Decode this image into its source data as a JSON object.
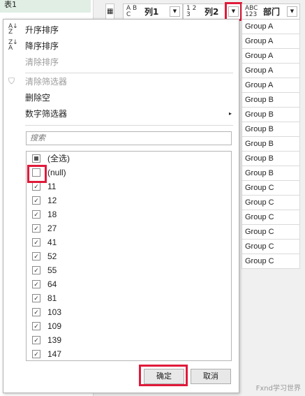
{
  "query_pane": {
    "item": "表1"
  },
  "columns": [
    {
      "type_badge": "A B C",
      "label": "列1"
    },
    {
      "type_badge": "1 2 3",
      "label": "列2"
    },
    {
      "type_badge": "ABC 123",
      "label": "部门"
    }
  ],
  "dept_values": [
    "Group A",
    "Group A",
    "Group A",
    "Group A",
    "Group A",
    "Group B",
    "Group B",
    "Group B",
    "Group B",
    "Group B",
    "Group B",
    "Group C",
    "Group C",
    "Group C",
    "Group C",
    "Group C",
    "Group C"
  ],
  "menu": {
    "sort_asc": "升序排序",
    "sort_desc": "降序排序",
    "clear_sort": "清除排序",
    "clear_filter": "清除筛选器",
    "remove_empty": "删除空",
    "number_filter": "数字筛选器"
  },
  "search_placeholder": "搜索",
  "filter_items": [
    {
      "label": "(全选)",
      "state": "partial"
    },
    {
      "label": "(null)",
      "state": "unchecked"
    },
    {
      "label": "11",
      "state": "checked"
    },
    {
      "label": "12",
      "state": "checked"
    },
    {
      "label": "18",
      "state": "checked"
    },
    {
      "label": "27",
      "state": "checked"
    },
    {
      "label": "41",
      "state": "checked"
    },
    {
      "label": "52",
      "state": "checked"
    },
    {
      "label": "55",
      "state": "checked"
    },
    {
      "label": "64",
      "state": "checked"
    },
    {
      "label": "81",
      "state": "checked"
    },
    {
      "label": "103",
      "state": "checked"
    },
    {
      "label": "109",
      "state": "checked"
    },
    {
      "label": "139",
      "state": "checked"
    },
    {
      "label": "147",
      "state": "checked"
    }
  ],
  "buttons": {
    "ok": "确定",
    "cancel": "取消"
  },
  "watermark": "Fxnd学习世界",
  "colors": {
    "highlight": "#e01a3a",
    "query_selected": "#e0eee4"
  }
}
